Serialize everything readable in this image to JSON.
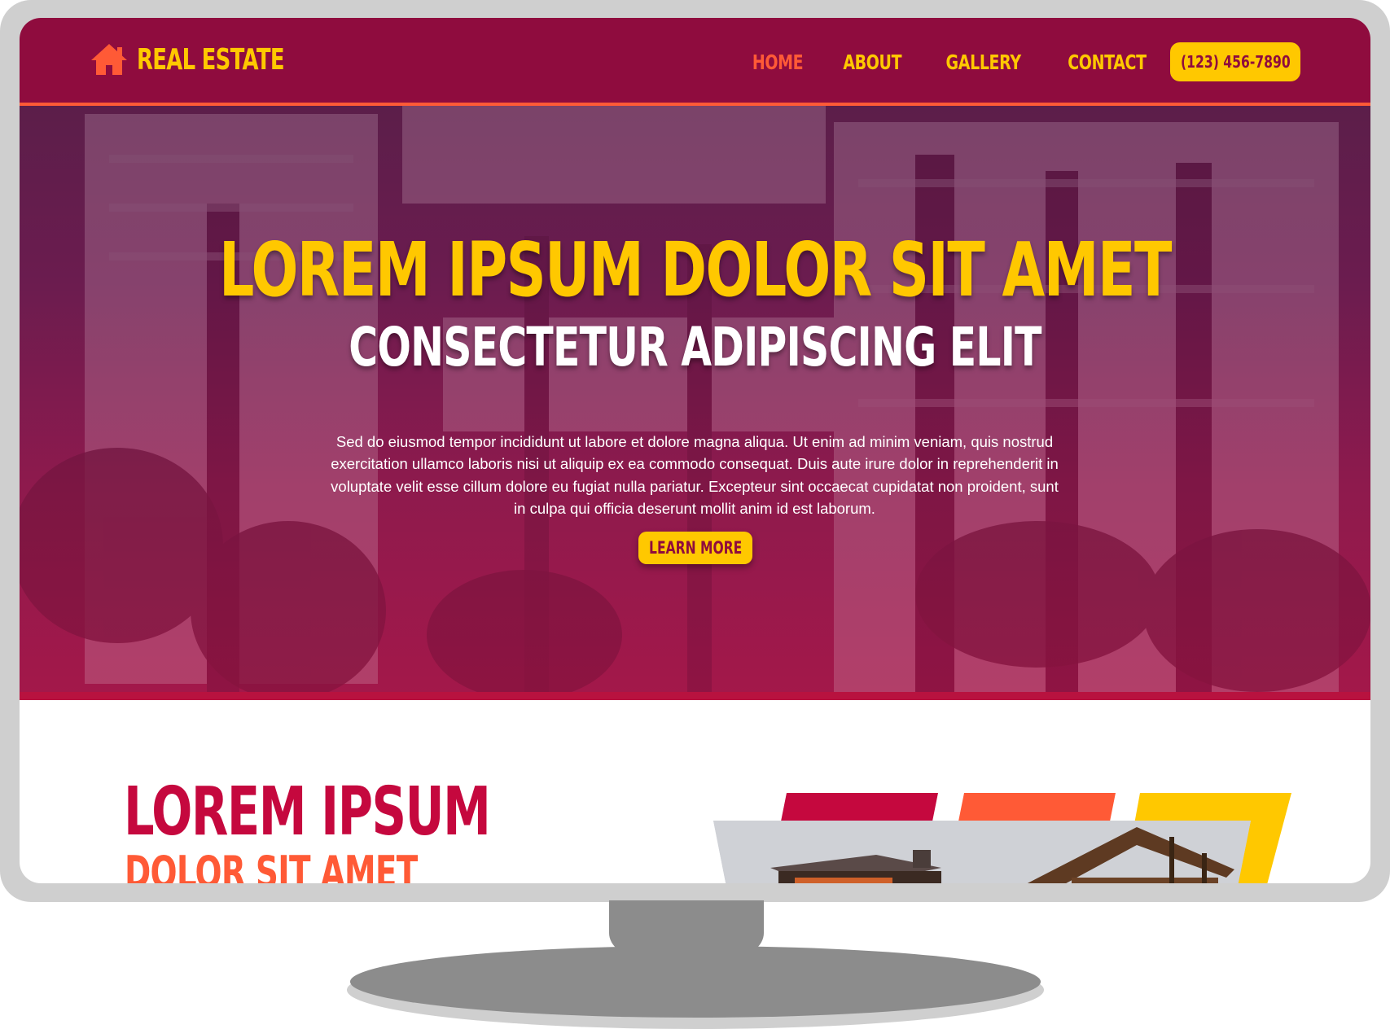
{
  "brand": {
    "name": "REAL ESTATE",
    "icon": "house-icon"
  },
  "nav": {
    "items": [
      {
        "label": "HOME",
        "active": true
      },
      {
        "label": "ABOUT",
        "active": false
      },
      {
        "label": "GALLERY",
        "active": false
      },
      {
        "label": "CONTACT",
        "active": false
      }
    ],
    "phone": "(123) 456-7890"
  },
  "hero": {
    "title": "LOREM IPSUM DOLOR SIT AMET",
    "subtitle": "CONSECTETUR ADIPISCING ELIT",
    "body": "Sed do eiusmod tempor incididunt ut labore et dolore magna aliqua. Ut enim ad minim veniam, quis nostrud exercitation ullamco laboris nisi ut aliquip ex ea commodo consequat. Duis aute irure dolor in reprehenderit in voluptate velit esse cillum dolore eu fugiat nulla pariatur. Excepteur sint occaecat cupidatat non proident, sunt in culpa qui officia deserunt mollit anim id est laborum.",
    "cta": "LEARN MORE"
  },
  "section": {
    "title": "LOREM IPSUM",
    "subtitle": "DOLOR SIT AMET"
  },
  "colors": {
    "header_bg": "#8f0c3e",
    "accent_yellow": "#ffc800",
    "accent_orange": "#ff5a36",
    "accent_crimson": "#c5083e",
    "frame": "#cfcfcf",
    "stand": "#8c8c8c"
  }
}
